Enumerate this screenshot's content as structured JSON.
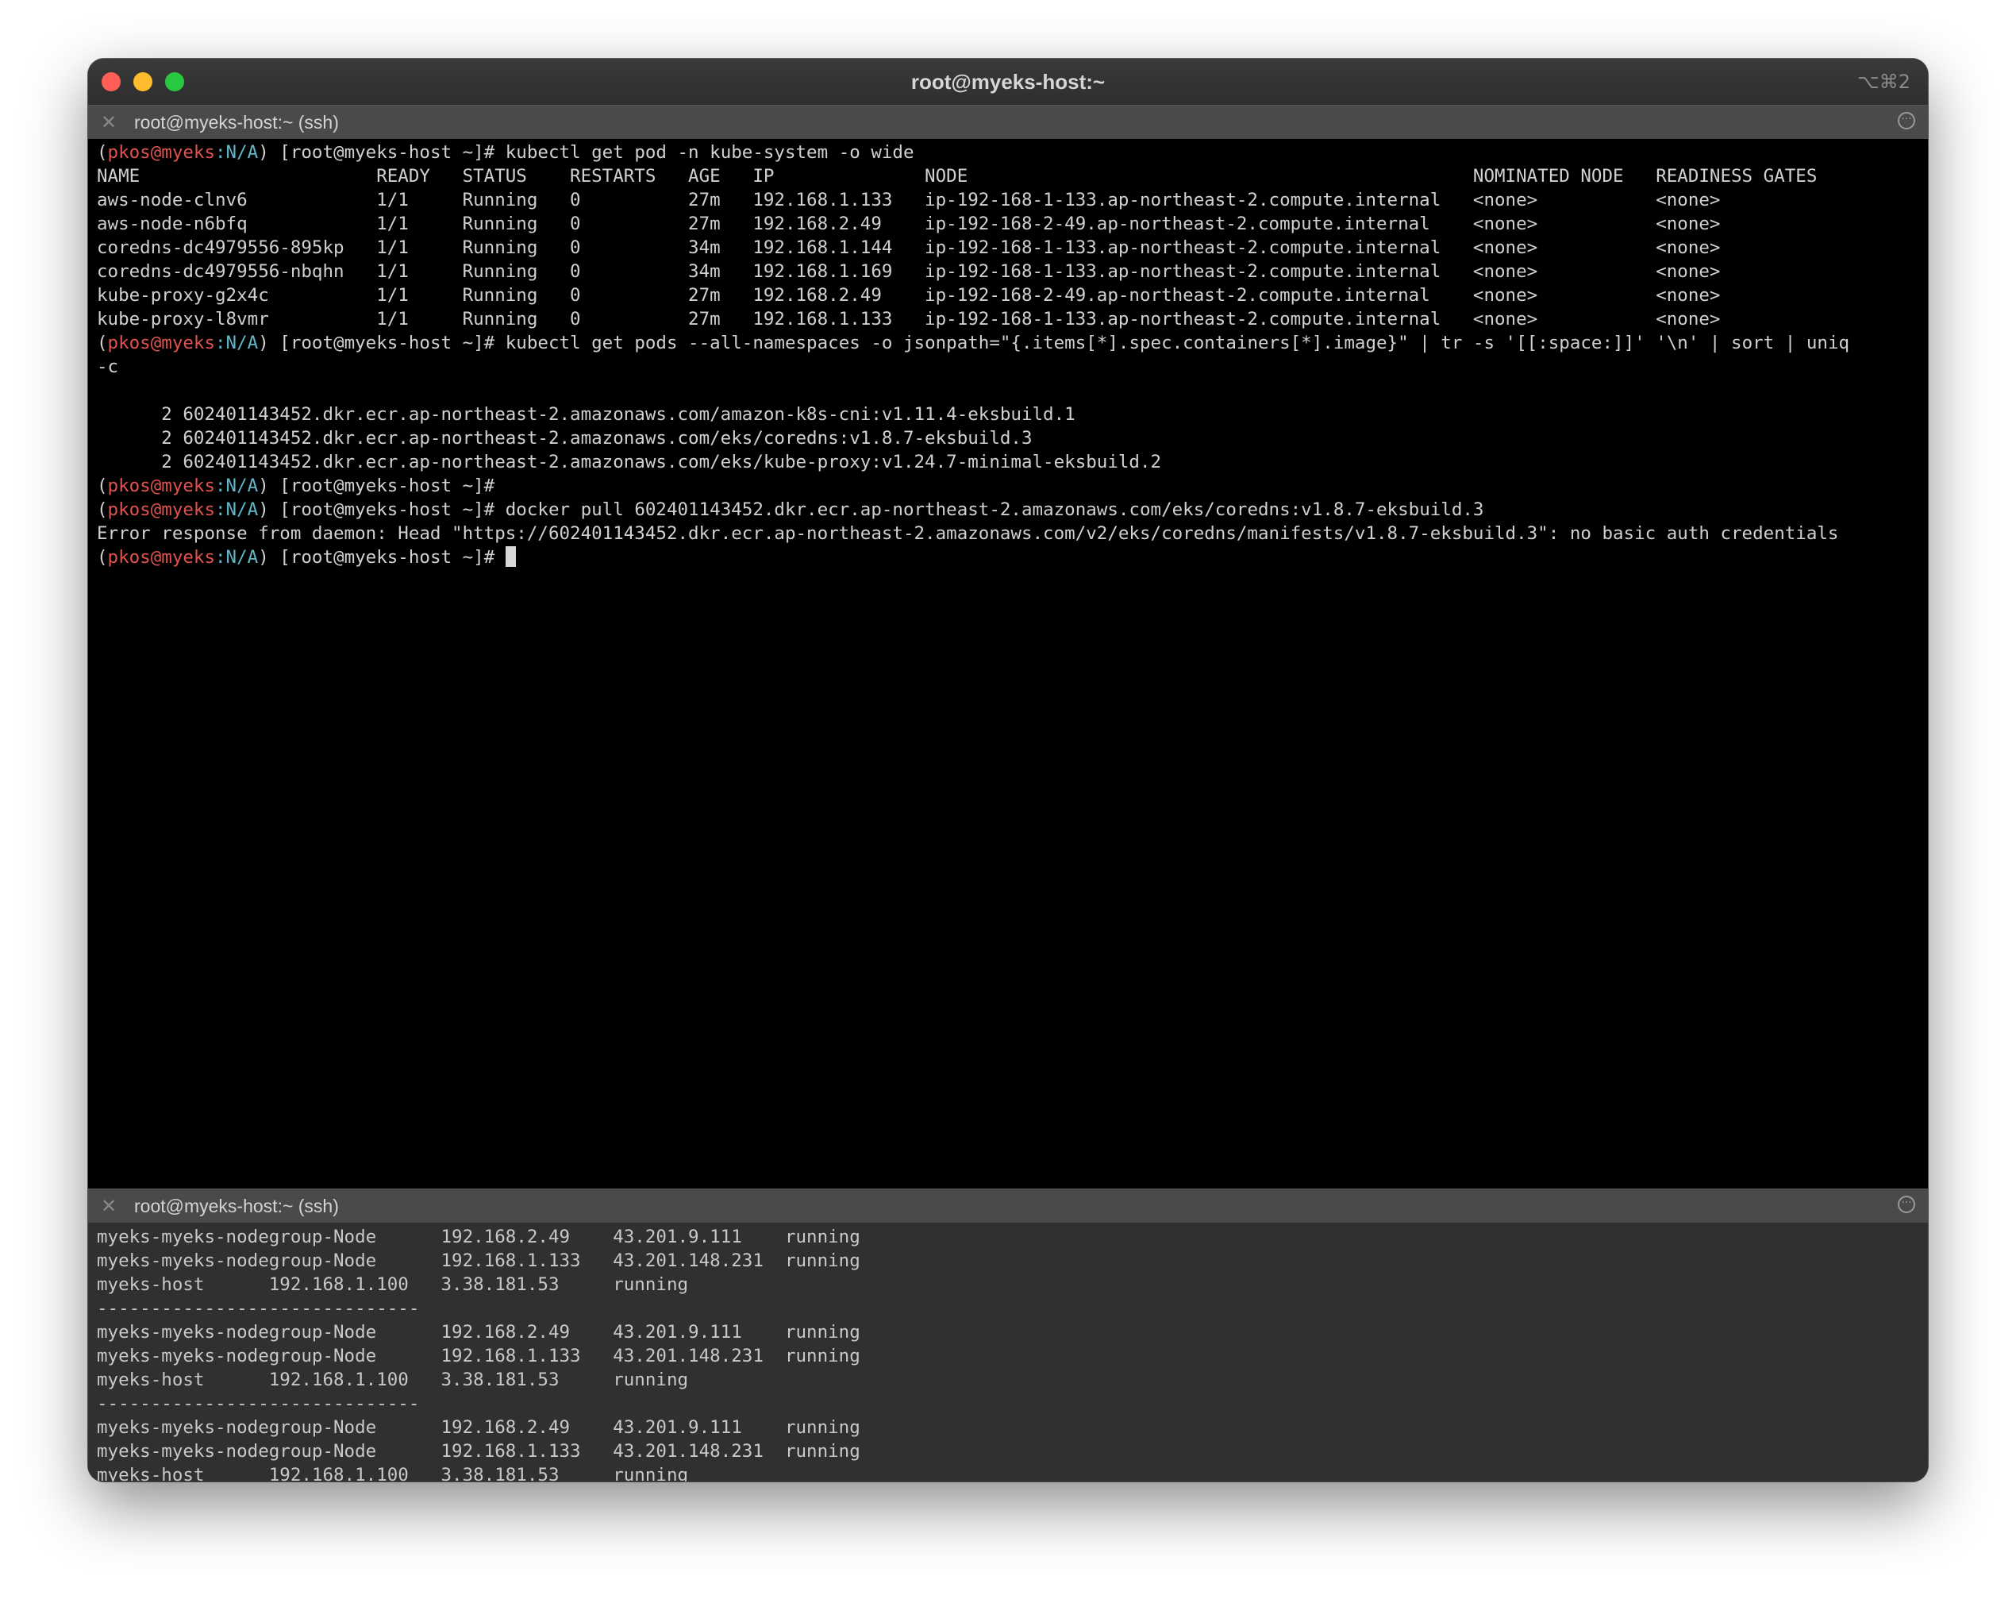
{
  "window": {
    "title": "root@myeks-host:~",
    "shortcut": "⌥⌘2"
  },
  "top_pane": {
    "tab_title": "root@myeks-host:~ (ssh)",
    "close_glyph": "✕",
    "more_glyph": "···",
    "prompt": {
      "open": "(",
      "user": "pkos",
      "at": "@",
      "cluster": "myeks",
      "ns": ":N/A",
      "rest": ") [root@myeks-host ~]# "
    },
    "commands": {
      "c1": "kubectl get pod -n kube-system -o wide",
      "c2": "kubectl get pods --all-namespaces -o jsonpath=\"{.items[*].spec.containers[*].image}\" | tr -s '[[:space:]]' '\\n' | sort | uniq",
      "c3": "",
      "c4": "docker pull 602401143452.dkr.ecr.ap-northeast-2.amazonaws.com/eks/coredns:v1.8.7-eksbuild.3",
      "c5": ""
    },
    "pod_table_lines": [
      "NAME                      READY   STATUS    RESTARTS   AGE   IP              NODE                                               NOMINATED NODE   READINESS GATES",
      "aws-node-clnv6            1/1     Running   0          27m   192.168.1.133   ip-192-168-1-133.ap-northeast-2.compute.internal   <none>           <none>",
      "aws-node-n6bfq            1/1     Running   0          27m   192.168.2.49    ip-192-168-2-49.ap-northeast-2.compute.internal    <none>           <none>",
      "coredns-dc4979556-895kp   1/1     Running   0          34m   192.168.1.144   ip-192-168-1-133.ap-northeast-2.compute.internal   <none>           <none>",
      "coredns-dc4979556-nbqhn   1/1     Running   0          34m   192.168.1.169   ip-192-168-1-133.ap-northeast-2.compute.internal   <none>           <none>",
      "kube-proxy-g2x4c          1/1     Running   0          27m   192.168.2.49    ip-192-168-2-49.ap-northeast-2.compute.internal    <none>           <none>",
      "kube-proxy-l8vmr          1/1     Running   0          27m   192.168.1.133   ip-192-168-1-133.ap-northeast-2.compute.internal   <none>           <none>"
    ],
    "wrap_line": "-c",
    "blank": "",
    "image_lines": [
      "      2 602401143452.dkr.ecr.ap-northeast-2.amazonaws.com/amazon-k8s-cni:v1.11.4-eksbuild.1",
      "      2 602401143452.dkr.ecr.ap-northeast-2.amazonaws.com/eks/coredns:v1.8.7-eksbuild.3",
      "      2 602401143452.dkr.ecr.ap-northeast-2.amazonaws.com/eks/kube-proxy:v1.24.7-minimal-eksbuild.2"
    ],
    "error_line": "Error response from daemon: Head \"https://602401143452.dkr.ecr.ap-northeast-2.amazonaws.com/v2/eks/coredns/manifests/v1.8.7-eksbuild.3\": no basic auth credentials"
  },
  "bottom_pane": {
    "tab_title": "root@myeks-host:~ (ssh)",
    "close_glyph": "✕",
    "more_glyph": "···",
    "lines": [
      "myeks-myeks-nodegroup-Node      192.168.2.49    43.201.9.111    running",
      "myeks-myeks-nodegroup-Node      192.168.1.133   43.201.148.231  running",
      "myeks-host      192.168.1.100   3.38.181.53     running",
      "------------------------------",
      "myeks-myeks-nodegroup-Node      192.168.2.49    43.201.9.111    running",
      "myeks-myeks-nodegroup-Node      192.168.1.133   43.201.148.231  running",
      "myeks-host      192.168.1.100   3.38.181.53     running",
      "------------------------------",
      "myeks-myeks-nodegroup-Node      192.168.2.49    43.201.9.111    running",
      "myeks-myeks-nodegroup-Node      192.168.1.133   43.201.148.231  running",
      "myeks-host      192.168.1.100   3.38.181.53     running",
      "------------------------------"
    ]
  },
  "colors": {
    "prompt_user": "#e0524f",
    "prompt_ns": "#5fb7c9",
    "close_button": "#ff5f57",
    "minimize_button": "#febc2e",
    "zoom_button": "#28c840"
  }
}
